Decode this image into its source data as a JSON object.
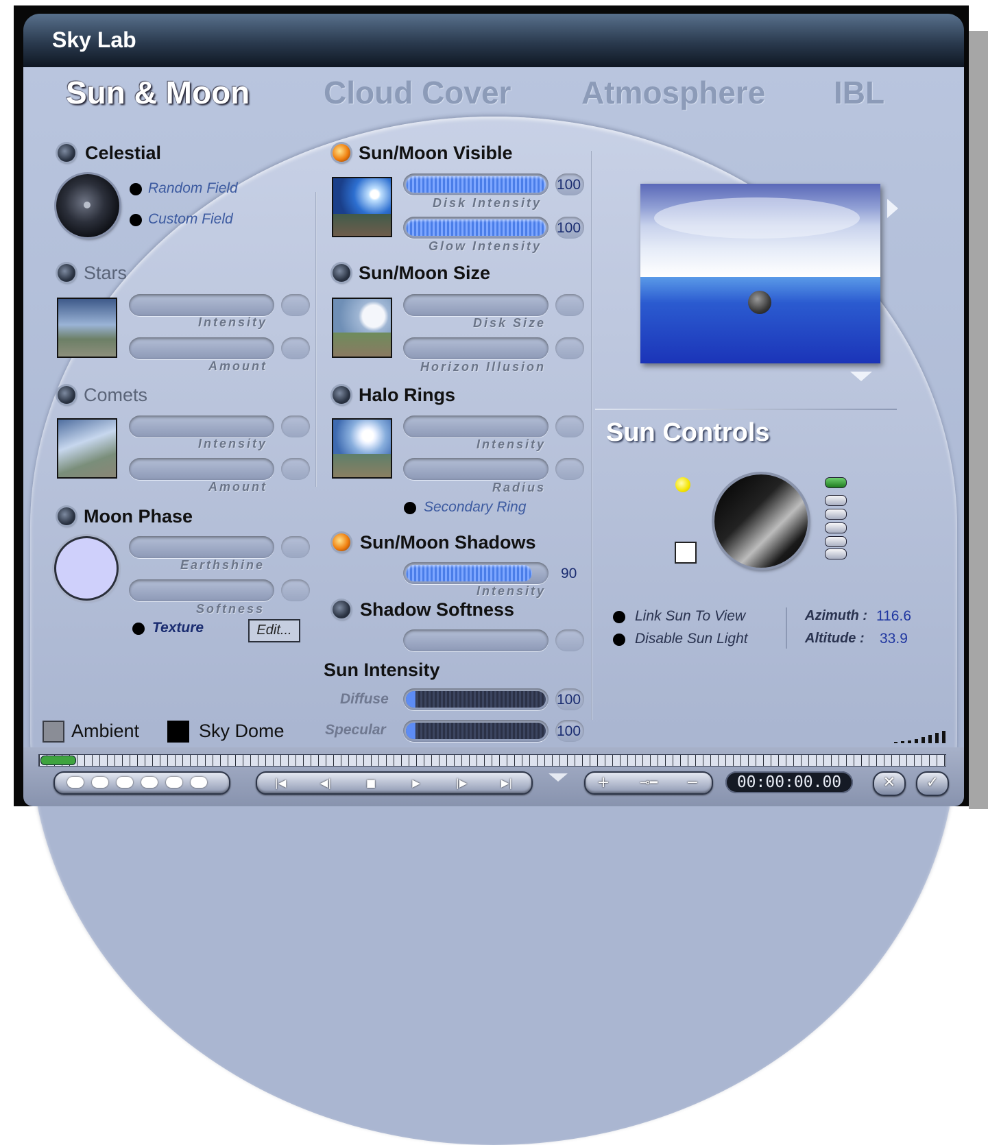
{
  "window": {
    "title": "Sky Lab"
  },
  "tabs": [
    {
      "label": "Sun & Moon",
      "active": true
    },
    {
      "label": "Cloud Cover",
      "active": false
    },
    {
      "label": "Atmosphere",
      "active": false
    },
    {
      "label": "IBL",
      "active": false
    }
  ],
  "left": {
    "celestial": {
      "title": "Celestial",
      "options": [
        "Random Field",
        "Custom Field"
      ]
    },
    "stars": {
      "title": "Stars",
      "sliders": [
        "Intensity",
        "Amount"
      ]
    },
    "comets": {
      "title": "Comets",
      "sliders": [
        "Intensity",
        "Amount"
      ]
    },
    "moon_phase": {
      "title": "Moon Phase",
      "sliders": [
        "Earthshine",
        "Softness"
      ],
      "texture_label": "Texture",
      "edit_button": "Edit..."
    },
    "ambient_label": "Ambient",
    "skydome_label": "Sky Dome"
  },
  "middle": {
    "visible": {
      "title": "Sun/Moon Visible",
      "disk_intensity_label": "Disk Intensity",
      "disk_intensity_value": "100",
      "glow_intensity_label": "Glow Intensity",
      "glow_intensity_value": "100"
    },
    "size": {
      "title": "Sun/Moon Size",
      "sliders": [
        "Disk Size",
        "Horizon Illusion"
      ]
    },
    "halo": {
      "title": "Halo Rings",
      "sliders": [
        "Intensity",
        "Radius"
      ],
      "secondary_ring": "Secondary Ring"
    },
    "shadows": {
      "title": "Sun/Moon Shadows",
      "intensity_label": "Intensity",
      "intensity_value": "90"
    },
    "shadow_softness": {
      "title": "Shadow Softness"
    },
    "sun_intensity": {
      "title": "Sun Intensity",
      "diffuse_label": "Diffuse",
      "diffuse_value": "100",
      "specular_label": "Specular",
      "specular_value": "100"
    }
  },
  "right": {
    "sun_controls_title": "Sun Controls",
    "link_sun": "Link Sun To View",
    "disable_sun": "Disable Sun Light",
    "azimuth_label": "Azimuth :",
    "azimuth_value": "116.6",
    "altitude_label": "Altitude :",
    "altitude_value": "33.9"
  },
  "timeline": {
    "time": "00:00:00.00"
  },
  "levels": {
    "disk_intensity": 1.0,
    "glow_intensity": 1.0,
    "shadow_intensity": 0.9
  },
  "colors": {
    "accent": "#4a7de8",
    "panel": "#b3bfd9",
    "led_on": "#f08010"
  }
}
